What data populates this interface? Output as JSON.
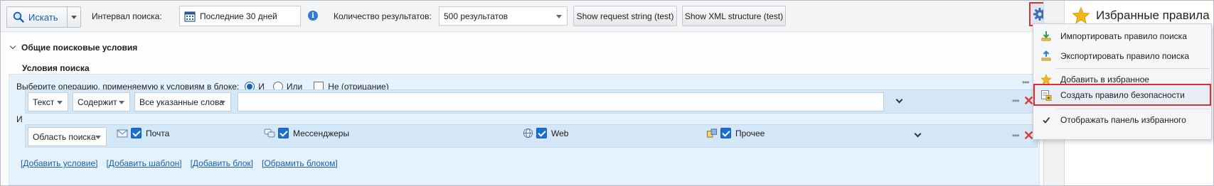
{
  "toolbar": {
    "search_label": "Искать",
    "interval_label": "Интервал поиска:",
    "interval_value": "Последние 30 дней",
    "results_label": "Количество результатов:",
    "results_value": "500 результатов",
    "request_string_button": "Show request string (test)",
    "xml_structure_button": "Show XML structure (test)"
  },
  "conditions": {
    "section_title": "Общие поисковые условия",
    "subsection_title": "Условия поиска",
    "operation_label": "Выберите операцию, применяемую к условиям в блоке:",
    "op_and": "И",
    "op_or": "Или",
    "op_not": "Не (отрицание)",
    "selected_operation": "И",
    "row1": {
      "field": "Текст",
      "operator": "Содержит",
      "mode": "Все указанные слова",
      "value": ""
    },
    "join_label": "И",
    "row2": {
      "field": "Область поиска",
      "sources": [
        {
          "label": "Почта",
          "checked": true,
          "icon": "mail-icon"
        },
        {
          "label": "Мессенджеры",
          "checked": true,
          "icon": "messenger-icon"
        },
        {
          "label": "Web",
          "checked": true,
          "icon": "globe-icon"
        },
        {
          "label": "Прочее",
          "checked": true,
          "icon": "other-icon"
        }
      ]
    },
    "links": [
      "[Добавить условие]",
      "[Добавить шаблон]",
      "[Добавить блок]",
      "[Обрамить блоком]"
    ]
  },
  "favorites": {
    "title": "Избранные правила п"
  },
  "menu": {
    "items": [
      {
        "label": "Импортировать правило поиска",
        "icon": "import-icon"
      },
      {
        "label": "Экспортировать правило поиска",
        "icon": "export-icon"
      },
      {
        "label": "Добавить в избранное",
        "icon": "star-icon"
      },
      {
        "label": "Создать правило безопасности",
        "icon": "create-rule-icon",
        "highlighted": true
      },
      {
        "label": "Отображать панель избранного",
        "icon": "checkmark-icon",
        "checked": true
      }
    ]
  },
  "colors": {
    "accent": "#1a5fb4",
    "highlight_border": "#e02d2d",
    "block_bg": "#e5f1fb",
    "row_bg": "#d4e7f7"
  }
}
